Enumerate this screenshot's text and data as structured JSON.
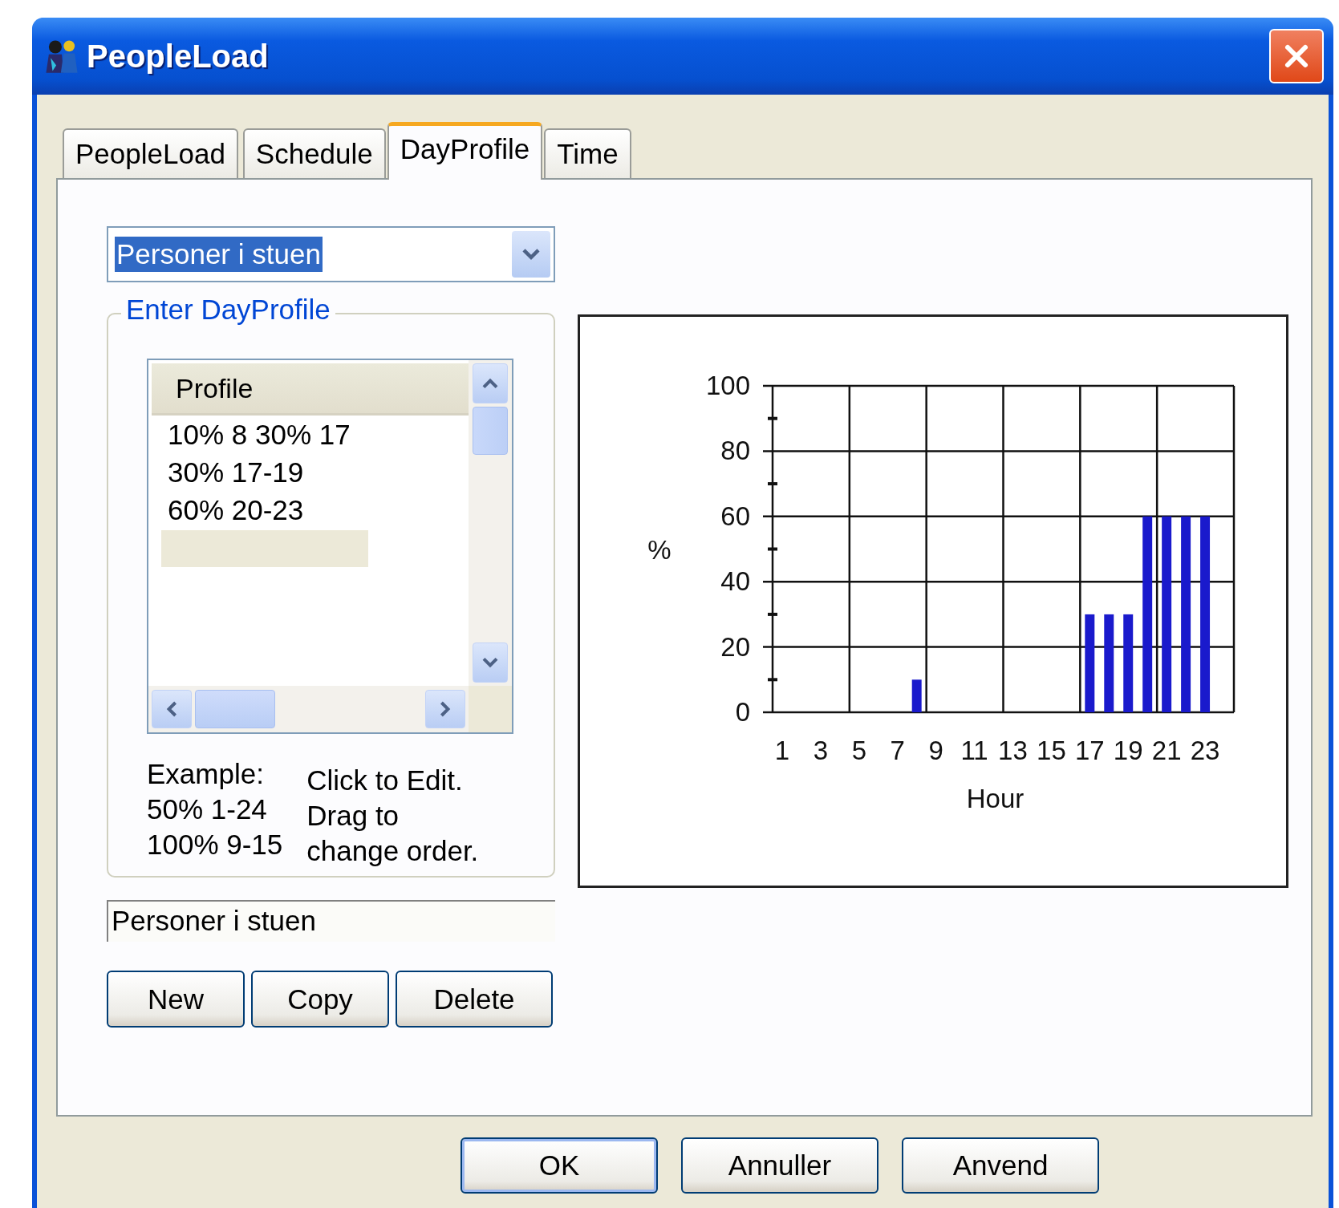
{
  "window": {
    "title": "PeopleLoad"
  },
  "tabs": [
    {
      "label": "PeopleLoad",
      "selected": false
    },
    {
      "label": "Schedule",
      "selected": false
    },
    {
      "label": "DayProfile",
      "selected": true
    },
    {
      "label": "Time",
      "selected": false
    }
  ],
  "profile_select": {
    "value": "Personer i stuen"
  },
  "group": {
    "legend": "Enter DayProfile",
    "list": {
      "header": "Profile",
      "rows": [
        "10% 8 30% 17",
        "30% 17-19",
        "60% 20-23"
      ]
    },
    "example": [
      "Example:",
      "50% 1-24",
      "100% 9-15"
    ],
    "hint": [
      "Click to Edit.",
      "Drag to",
      "change order."
    ]
  },
  "name_field": {
    "value": "Personer i stuen"
  },
  "profile_buttons": [
    "New",
    "Copy",
    "Delete"
  ],
  "chart": {
    "chart_data": {
      "type": "bar",
      "xlabel": "Hour",
      "ylabel": "%",
      "x": [
        8,
        17,
        18,
        19,
        20,
        21,
        22,
        23
      ],
      "series": [
        {
          "color": "#1a1acc",
          "values": [
            10,
            30,
            30,
            30,
            60,
            60,
            60,
            60
          ]
        }
      ],
      "xlim": [
        0.5,
        24.5
      ],
      "grid": true,
      "ylim": [
        0,
        100
      ],
      "yticks": [
        0,
        20,
        40,
        60,
        80,
        100
      ],
      "xticks": [
        1,
        3,
        5,
        7,
        9,
        11,
        13,
        15,
        17,
        19,
        21,
        23
      ]
    }
  },
  "dialog_buttons": [
    "OK",
    "Annuller",
    "Anvend"
  ]
}
